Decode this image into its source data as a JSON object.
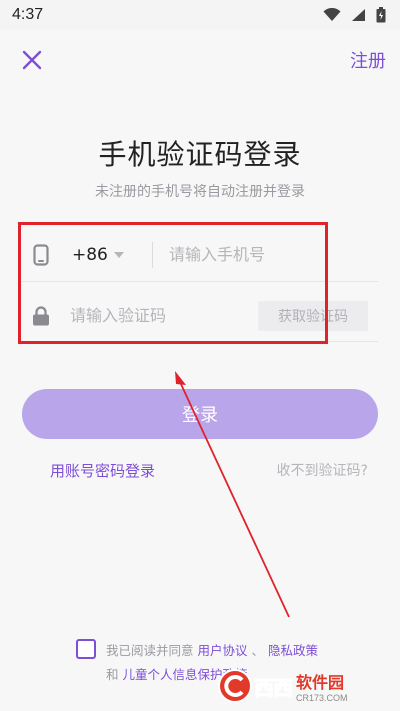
{
  "status_bar": {
    "time": "4:37"
  },
  "nav": {
    "close_icon": "close-icon",
    "register_label": "注册"
  },
  "title": "手机验证码登录",
  "subtitle": "未注册的手机号将自动注册并登录",
  "phone": {
    "icon": "phone-icon",
    "country_code": "+86",
    "placeholder": "请输入手机号",
    "value": ""
  },
  "code": {
    "icon": "lock-icon",
    "placeholder": "请输入验证码",
    "value": "",
    "get_code_label": "获取验证码"
  },
  "login_button": "登录",
  "password_login": "用账号密码登录",
  "no_code": "收不到验证码?",
  "agreement": {
    "prefix": "我已阅读并同意",
    "user_agreement": "用户协议",
    "sep": "、",
    "privacy": "隐私政策",
    "and": "和",
    "child_privacy": "儿童个人信息保护政策",
    "checked": false
  },
  "watermark": {
    "main": "西西",
    "sub": "软件园",
    "url": "CR173.COM"
  },
  "colors": {
    "accent": "#7d4fd6",
    "button_disabled": "#b9a6ea",
    "annotation": "#e0222a"
  }
}
